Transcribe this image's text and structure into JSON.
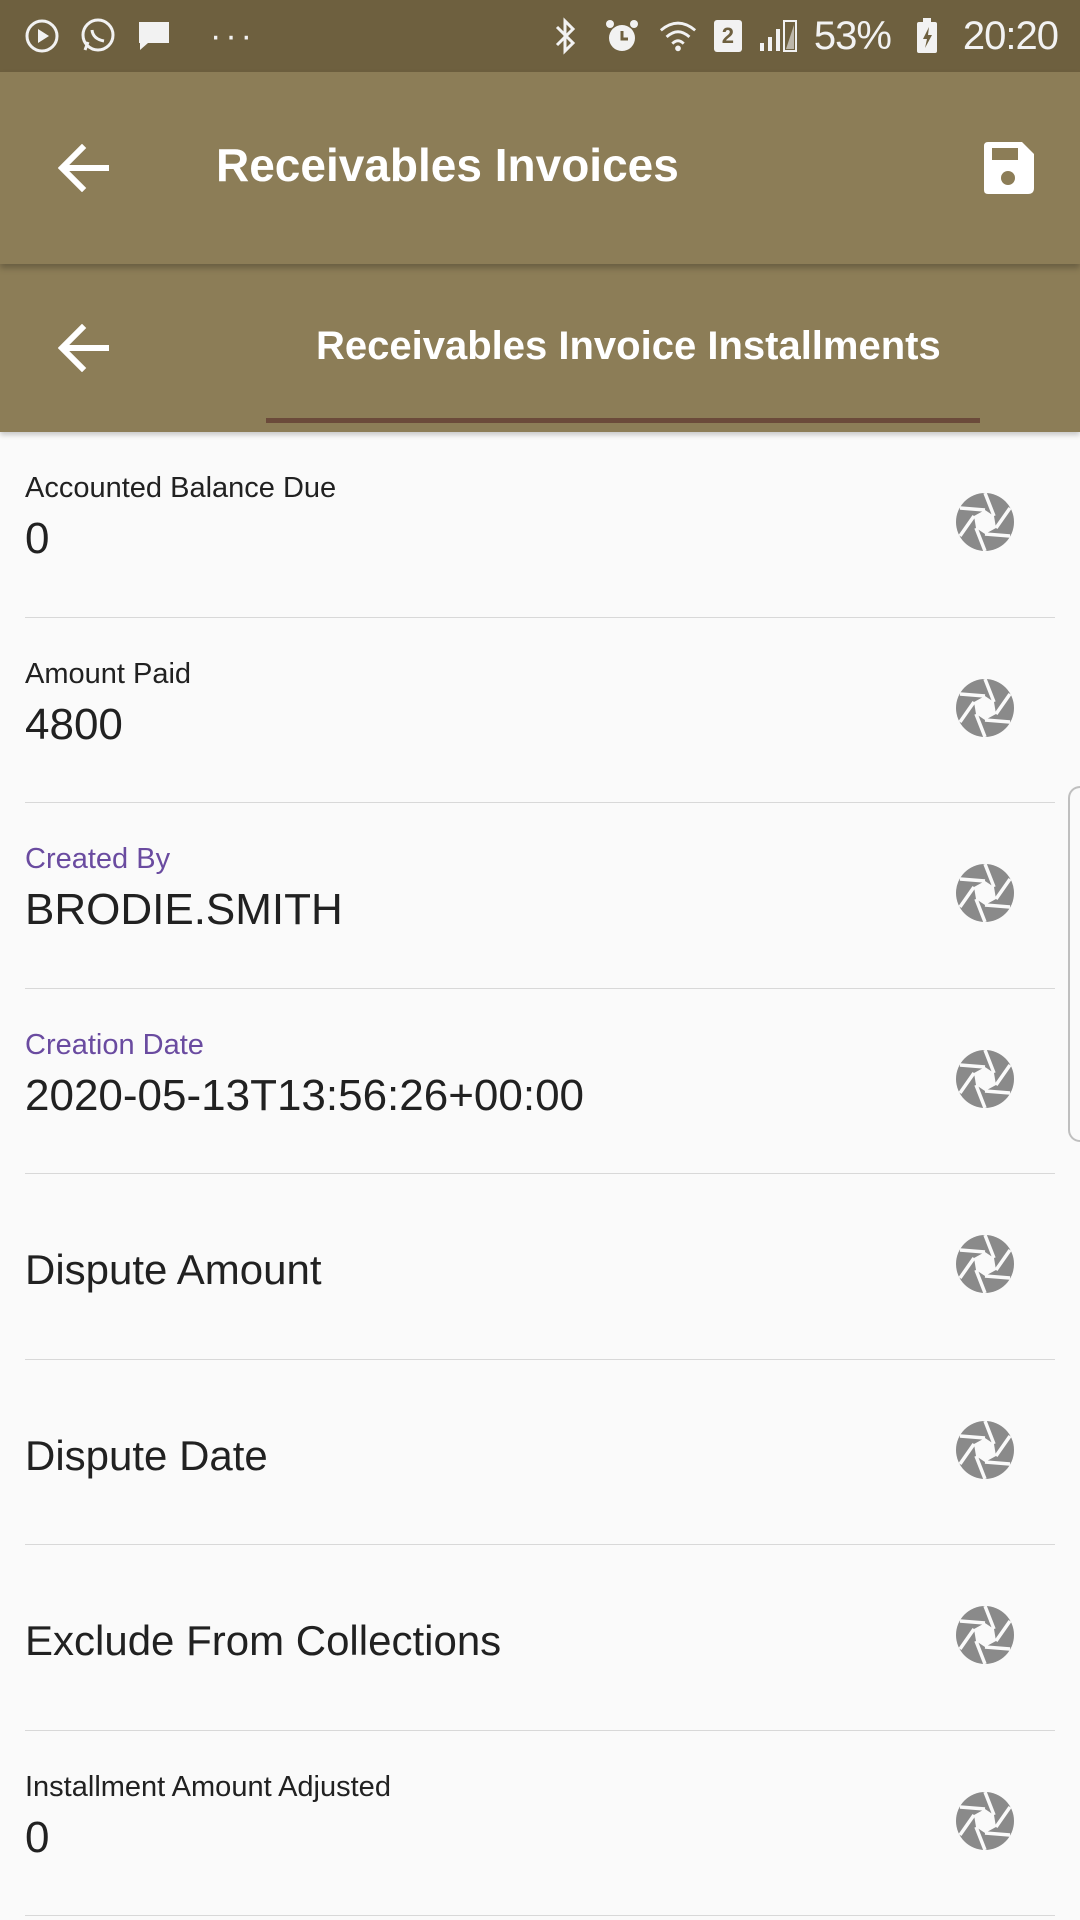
{
  "status_bar": {
    "left_icons": [
      "play-circle-icon",
      "whatsapp-icon",
      "message-icon"
    ],
    "overflow": "···",
    "right_icons": [
      "bluetooth-icon",
      "alarm-icon",
      "wifi-icon",
      "signal-icon",
      "battery-icon"
    ],
    "sim_badge": "2",
    "battery_percent": "53%",
    "time": "20:20"
  },
  "app_bar": {
    "title": "Receivables Invoices"
  },
  "sub_bar": {
    "tab_label": "Receivables Invoice Installments"
  },
  "fields": [
    {
      "label": "Accounted Balance Due",
      "value": "0",
      "label_color": "#212121"
    },
    {
      "label": "Amount Paid",
      "value": "4800",
      "label_color": "#212121"
    },
    {
      "label": "Created By",
      "value": "BRODIE.SMITH",
      "label_color": "#6a4ba0"
    },
    {
      "label": "Creation Date",
      "value": "2020-05-13T13:56:26+00:00",
      "label_color": "#6a4ba0"
    },
    {
      "label": "Dispute Amount"
    },
    {
      "label": "Dispute Date"
    },
    {
      "label": "Exclude From Collections"
    },
    {
      "label": "Installment Amount Adjusted",
      "value": "0",
      "label_color": "#212121"
    }
  ],
  "colors": {
    "status_bar_bg": "#6e603f",
    "app_bar_bg": "#8c7d57",
    "tab_indicator": "#6b4a3a",
    "accent_label": "#6a4ba0",
    "icon_gray": "#8a8a8a"
  }
}
